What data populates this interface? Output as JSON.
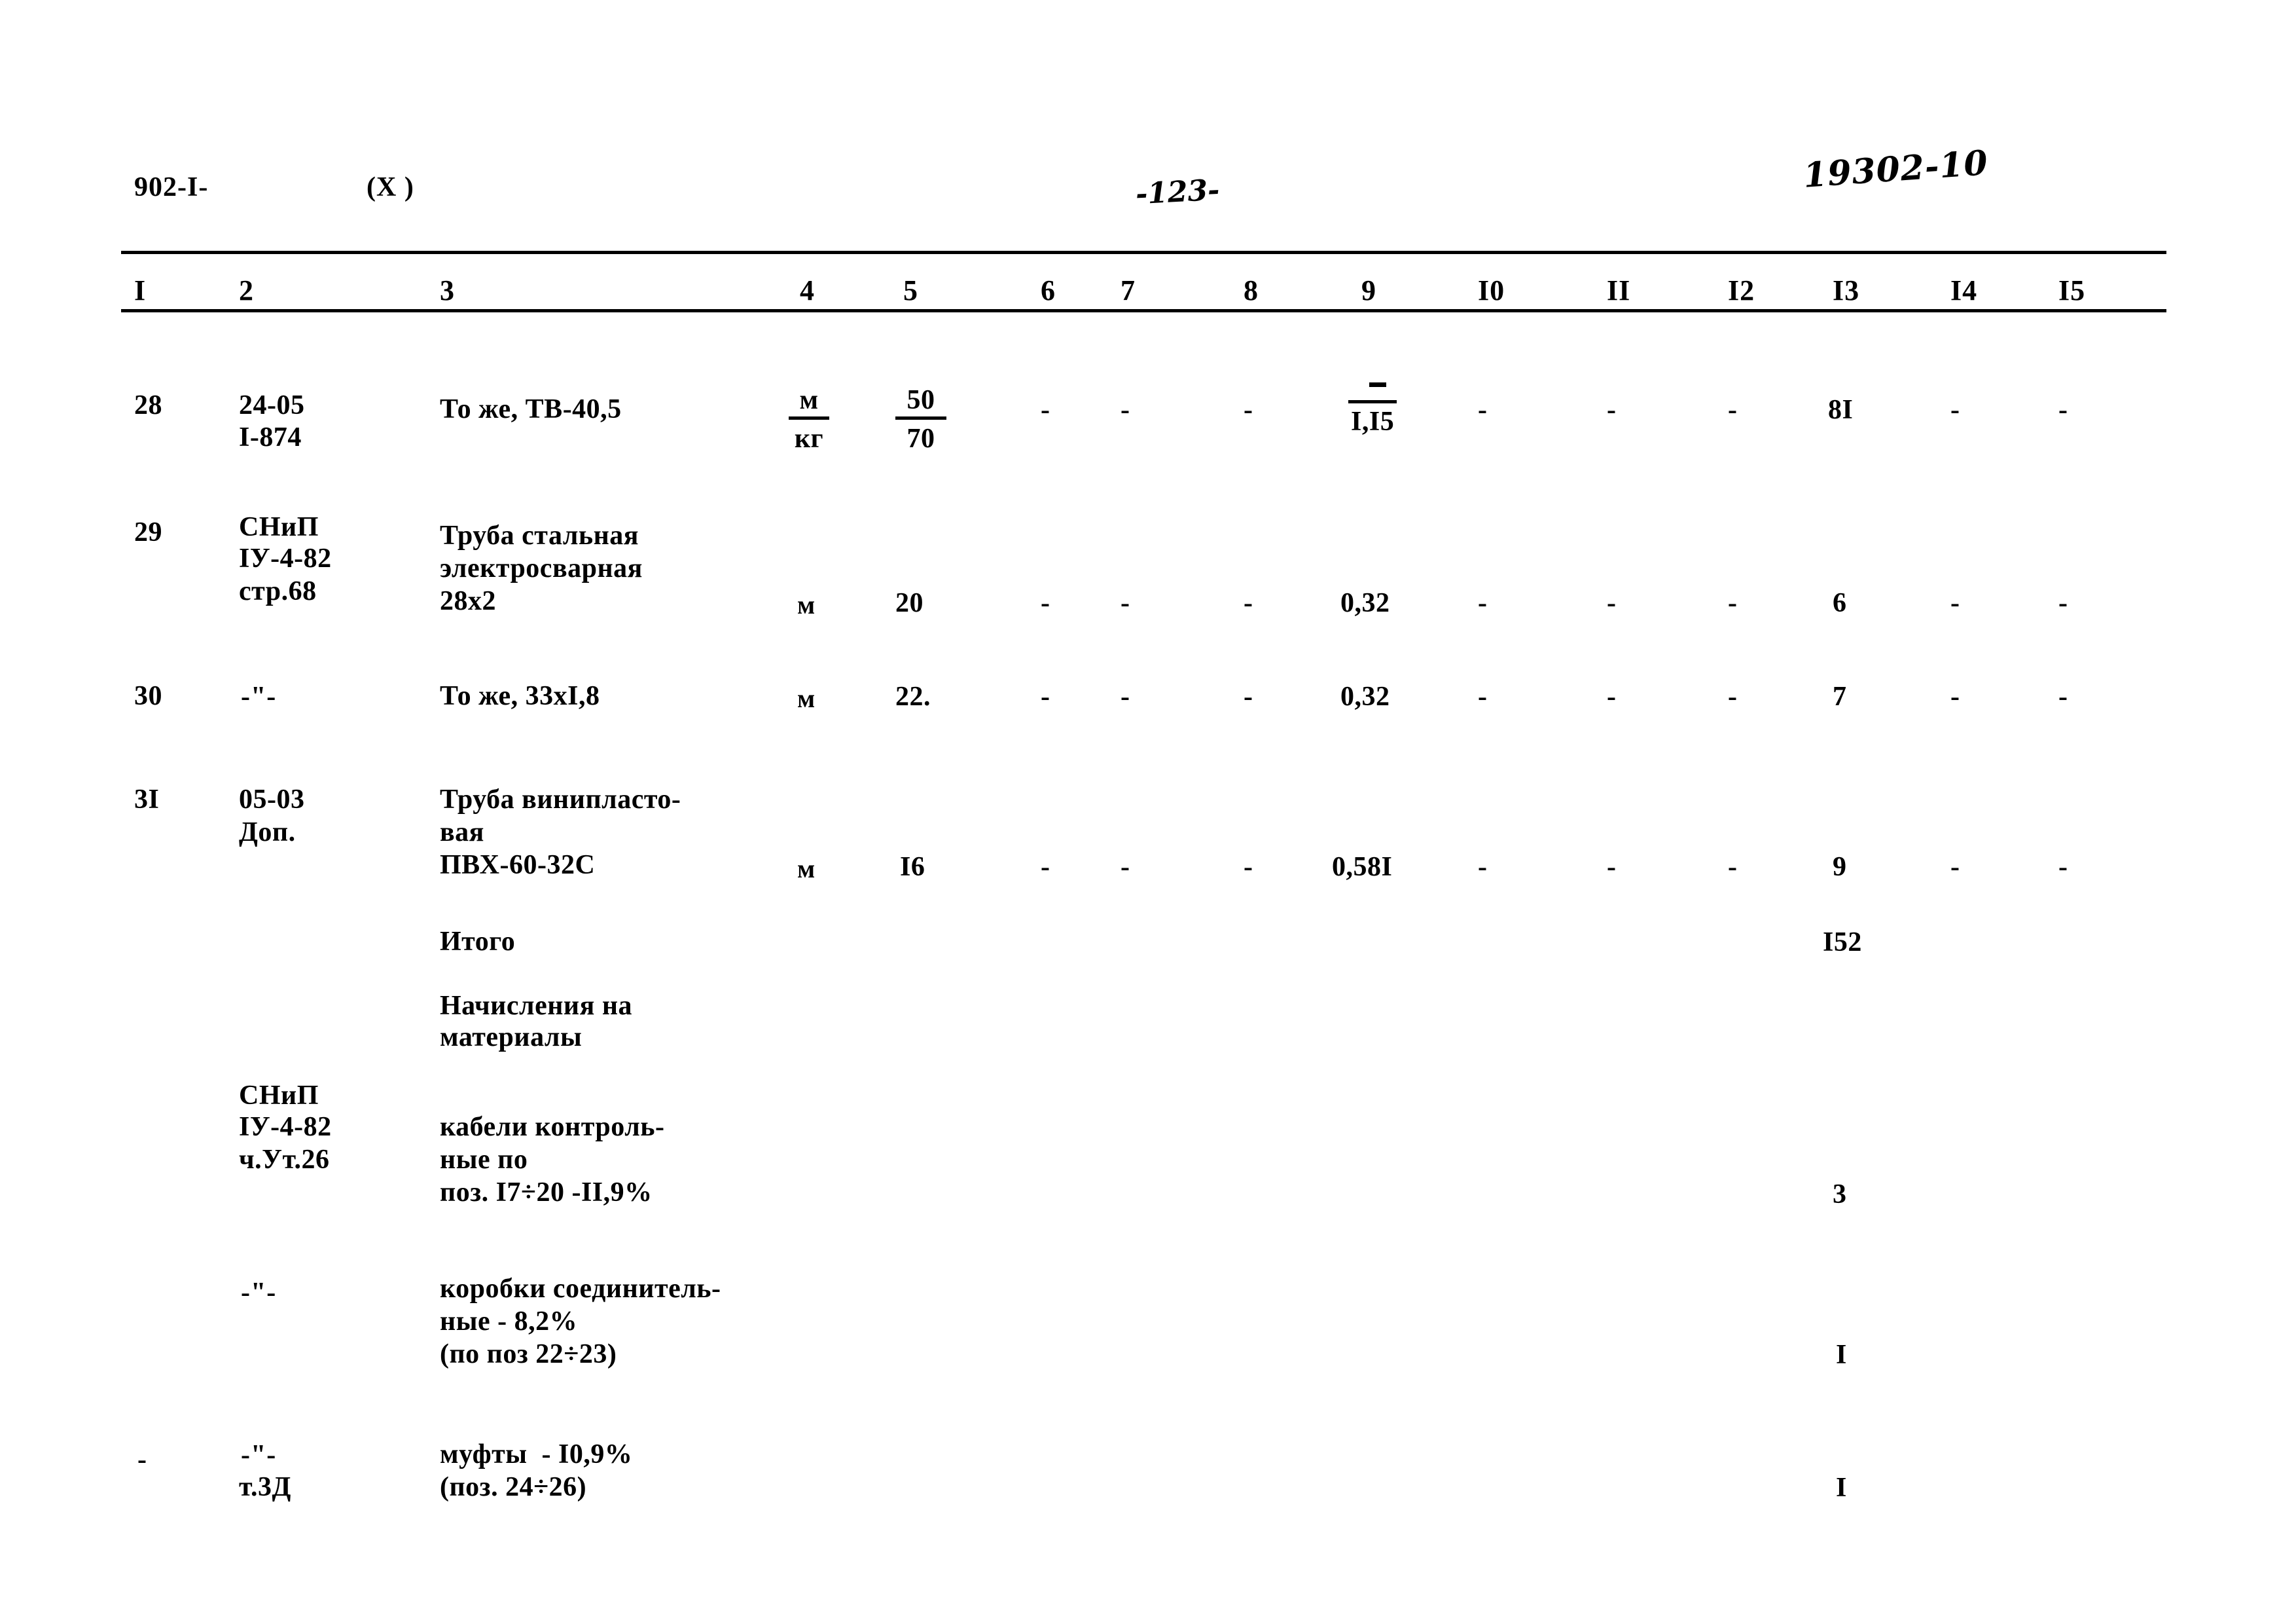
{
  "header": {
    "doc_code": "902-I-",
    "doc_variant": "(X )",
    "page_number": "-123-",
    "stamp_number": "19302-10"
  },
  "table": {
    "column_headers": [
      "I",
      "2",
      "3",
      "4",
      "5",
      "6",
      "7",
      "8",
      "9",
      "I0",
      "II",
      "I2",
      "I3",
      "I4",
      "I5"
    ],
    "rows": [
      {
        "pos": "28",
        "ref_line1": "24-05",
        "ref_line2": "I-874",
        "name": "То же, ТВ-40,5",
        "unit_top": "м",
        "unit_bottom": "кг",
        "qty_top": "50",
        "qty_bottom": "70",
        "c6": "-",
        "c7": "-",
        "c8": "-",
        "c9": "I,I5",
        "c10": "-",
        "c11": "-",
        "c12": "-",
        "c13": "8I",
        "c14": "-",
        "c15": "-"
      },
      {
        "pos": "29",
        "ref_line1": "СНиП",
        "ref_line2": "IУ-4-82",
        "ref_line3": "стр.68",
        "name_line1": "Труба стальная",
        "name_line2": "электросварная",
        "name_line3": "28х2",
        "unit": "м",
        "qty": "20",
        "c6": "-",
        "c7": "-",
        "c8": "-",
        "c9": "0,32",
        "c10": "-",
        "c11": "-",
        "c12": "-",
        "c13": "6",
        "c14": "-",
        "c15": "-"
      },
      {
        "pos": "30",
        "ref_line1": "-\"-",
        "name_line1": "То же, 33хI,8",
        "unit": "м",
        "qty": "22.",
        "c6": "-",
        "c7": "-",
        "c8": "-",
        "c9": "0,32",
        "c10": "-",
        "c11": "-",
        "c12": "-",
        "c13": "7",
        "c14": "-",
        "c15": "-"
      },
      {
        "pos": "3I",
        "ref_line1": "05-03",
        "ref_line2": "Доп.",
        "name_line1": "Труба винипласто-",
        "name_line2": "вая",
        "name_line3": "ПВХ-60-32С",
        "unit": "м",
        "qty": "I6",
        "c6": "-",
        "c7": "-",
        "c8": "-",
        "c9": "0,58I",
        "c10": "-",
        "c11": "-",
        "c12": "-",
        "c13": "9",
        "c14": "-",
        "c15": "-"
      }
    ],
    "total": {
      "label": "Итого",
      "value": "I52"
    },
    "surcharge_heading_line1": "Начисления на",
    "surcharge_heading_line2": "материалы",
    "surcharges": [
      {
        "ref_line1": "СНиП",
        "ref_line2": "IУ-4-82",
        "ref_line3": "ч.Ут.26",
        "name_line1": "кабели контроль-",
        "name_line2": "ные по",
        "name_line3": "поз. I7÷20 -II,9%",
        "value": "3"
      },
      {
        "ref_line1": "-\"-",
        "name_line1": "коробки соединитель-",
        "name_line2": "ные - 8,2%",
        "name_line3": "(по поз 22÷23)",
        "value": "I"
      },
      {
        "pos": "-",
        "ref_line1": "-\"-",
        "ref_line2": "т.3Д",
        "name_line1": "муфты  - I0,9%",
        "name_line2": "(поз. 24÷26)",
        "value": "I"
      }
    ]
  }
}
